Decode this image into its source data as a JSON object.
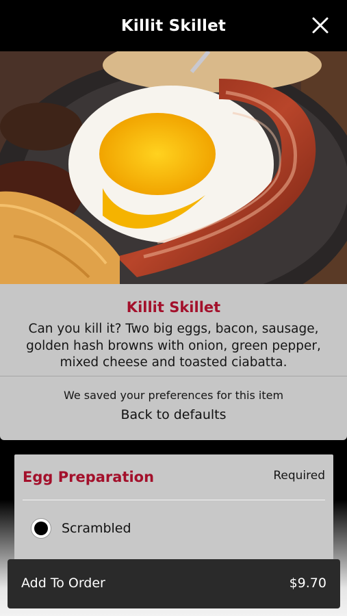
{
  "header": {
    "title": "Killit Skillet",
    "close_icon": "close-icon"
  },
  "item": {
    "name": "Killit Skillet",
    "description": "Can you kill it? Two big eggs, bacon, sausage, golden hash browns with onion, green pepper, mixed cheese and toasted ciabatta.",
    "saved_message": "We saved your preferences for this item",
    "reset_label": "Back to defaults"
  },
  "modifier_group": {
    "title": "Egg Preparation",
    "requirement": "Required",
    "options": [
      {
        "label": "Scrambled",
        "selected": true
      }
    ]
  },
  "footer": {
    "add_label": "Add To Order",
    "price": "$9.70"
  },
  "colors": {
    "accent": "#a3102b",
    "panel": "#c6c6c6",
    "bar": "#2a2a2a"
  }
}
